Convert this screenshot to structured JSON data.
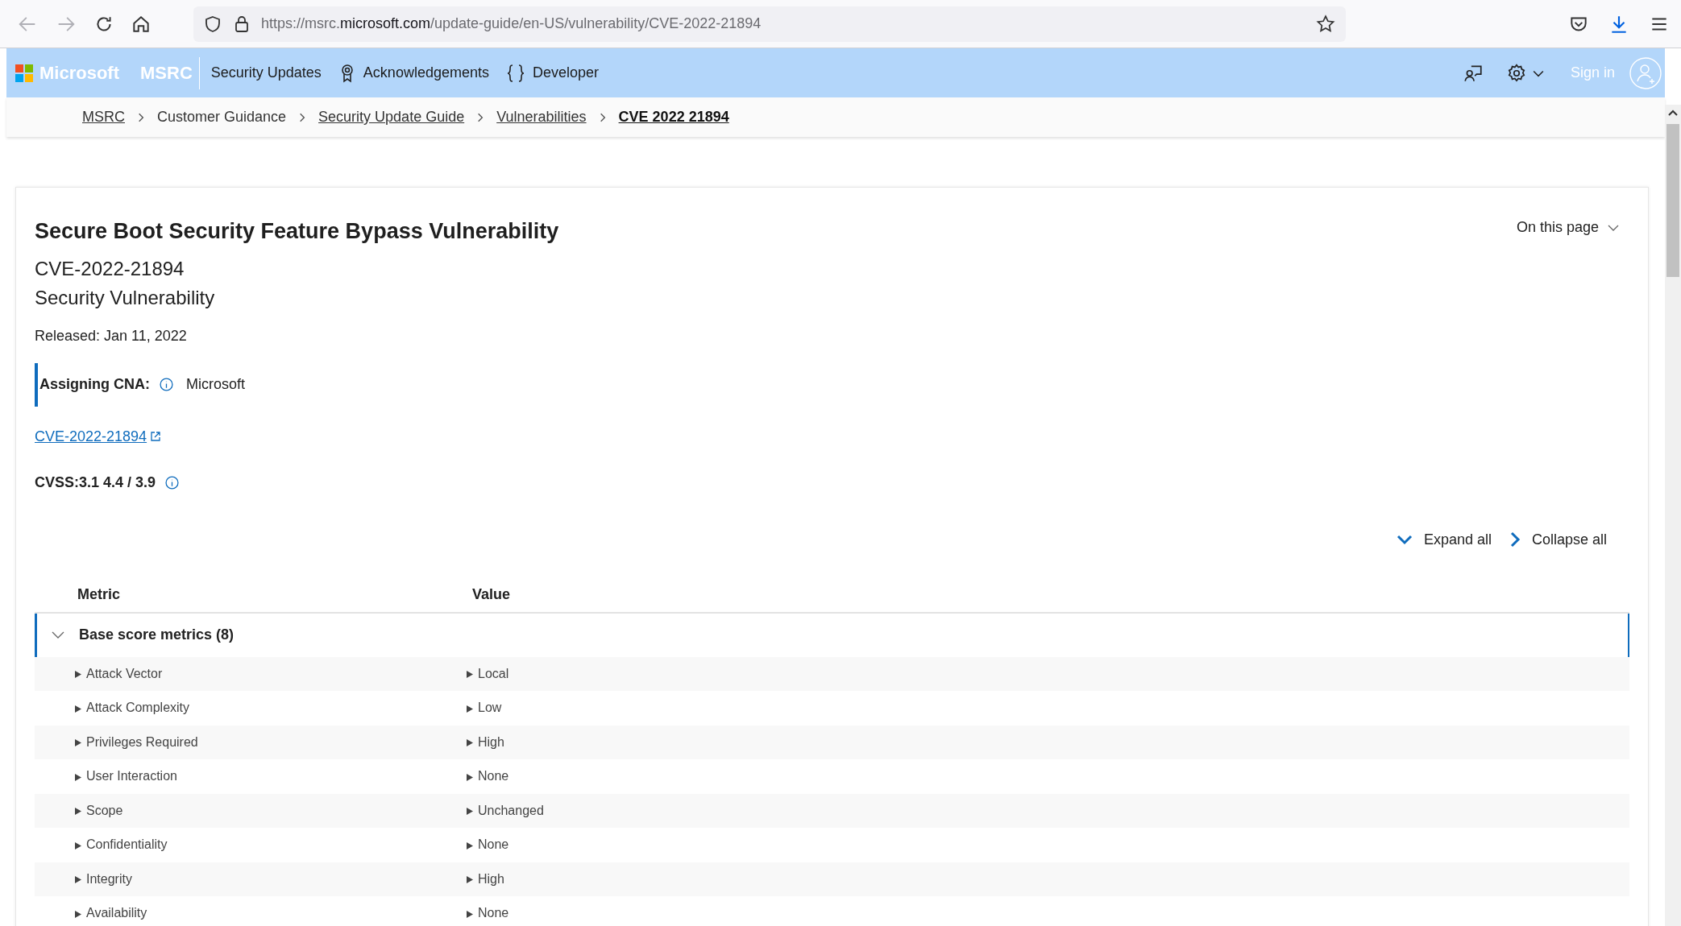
{
  "browser": {
    "url": "https://msrc.**microsoft.com**/update-guide/en-US/vulnerability/CVE-2022-21894"
  },
  "header": {
    "brand": "Microsoft",
    "site": "MSRC",
    "nav": [
      {
        "label": "Security Updates",
        "kind": "plain"
      },
      {
        "label": "Acknowledgements",
        "kind": "ribbon"
      },
      {
        "label": "Developer",
        "kind": "braces"
      }
    ],
    "sign_in": "Sign in"
  },
  "breadcrumb": [
    {
      "label": "MSRC",
      "kind": "link"
    },
    {
      "label": "Customer Guidance",
      "kind": "text"
    },
    {
      "label": "Security Update Guide",
      "kind": "link"
    },
    {
      "label": "Vulnerabilities",
      "kind": "link"
    },
    {
      "label": "CVE 2022 21894",
      "kind": "current"
    }
  ],
  "card": {
    "title": "Secure Boot Security Feature Bypass Vulnerability",
    "cve_id": "CVE-2022-21894",
    "subtitle": "Security Vulnerability",
    "released": "Released: Jan 11, 2022",
    "assigning_cna": {
      "label": "Assigning CNA:",
      "value": "Microsoft"
    },
    "cve_link": "CVE-2022-21894",
    "cvss": "CVSS:3.1 4.4 / 3.9",
    "on_this_page": "On this page",
    "expand_all": "Expand all",
    "collapse_all": "Collapse all",
    "table": {
      "columns": [
        "Metric",
        "Value"
      ],
      "groups": [
        {
          "label": "Base score metrics (8)",
          "expanded": true,
          "rows": [
            {
              "metric": "Attack Vector",
              "value": "Local"
            },
            {
              "metric": "Attack Complexity",
              "value": "Low"
            },
            {
              "metric": "Privileges Required",
              "value": "High"
            },
            {
              "metric": "User Interaction",
              "value": "None"
            },
            {
              "metric": "Scope",
              "value": "Unchanged"
            },
            {
              "metric": "Confidentiality",
              "value": "None"
            },
            {
              "metric": "Integrity",
              "value": "High"
            },
            {
              "metric": "Availability",
              "value": "None"
            }
          ]
        }
      ]
    }
  }
}
